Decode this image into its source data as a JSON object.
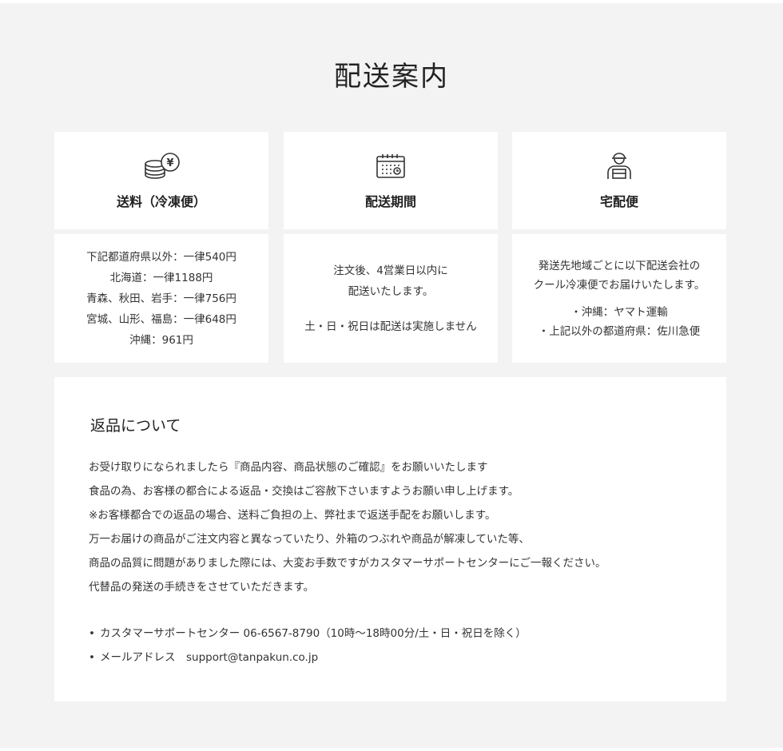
{
  "title": "配送案内",
  "cards": [
    {
      "icon": "coins-yen-icon",
      "label": "送料（冷凍便）",
      "lines": [
        "下記都道府県以外：一律540円",
        "北海道：一律1188円",
        "青森、秋田、岩手：一律756円",
        "宮城、山形、福島：一律648円",
        "沖縄：961円"
      ]
    },
    {
      "icon": "calendar-icon",
      "label": "配送期間",
      "lines": [
        "注文後、4営業日以内に",
        "配送いたします。"
      ],
      "note": "土・日・祝日は配送は実施しません"
    },
    {
      "icon": "delivery-person-icon",
      "label": "宅配便",
      "lines": [
        "発送先地域ごとに以下配送会社の",
        "クール冷凍便でお届けいたします。"
      ],
      "carriers": [
        "・沖縄：ヤマト運輸",
        "・上記以外の都道府県：佐川急便"
      ]
    }
  ],
  "returns": {
    "title": "返品について",
    "paragraph": [
      "お受け取りになられましたら『商品内容、商品状態のご確認』をお願いいたします",
      "食品の為、お客様の都合による返品・交換はご容赦下さいますようお願い申し上げます。",
      "※お客様都合での返品の場合、送料ご負担の上、弊社まで返送手配をお願いします。",
      "万一お届けの商品がご注文内容と異なっていたり、外箱のつぶれや商品が解凍していた等、",
      "商品の品質に問題がありました際には、大変お手数ですがカスタマーサポートセンターにご一報ください。",
      "代替品の発送の手続きをさせていただきます。"
    ],
    "contacts": [
      {
        "bullet": "•",
        "text": "カスタマーサポートセンター 06-6567-8790（10時〜18時00分/土・日・祝日を除く）"
      },
      {
        "bullet": "•",
        "text": "メールアドレス　support@tanpakun.co.jp"
      }
    ]
  }
}
